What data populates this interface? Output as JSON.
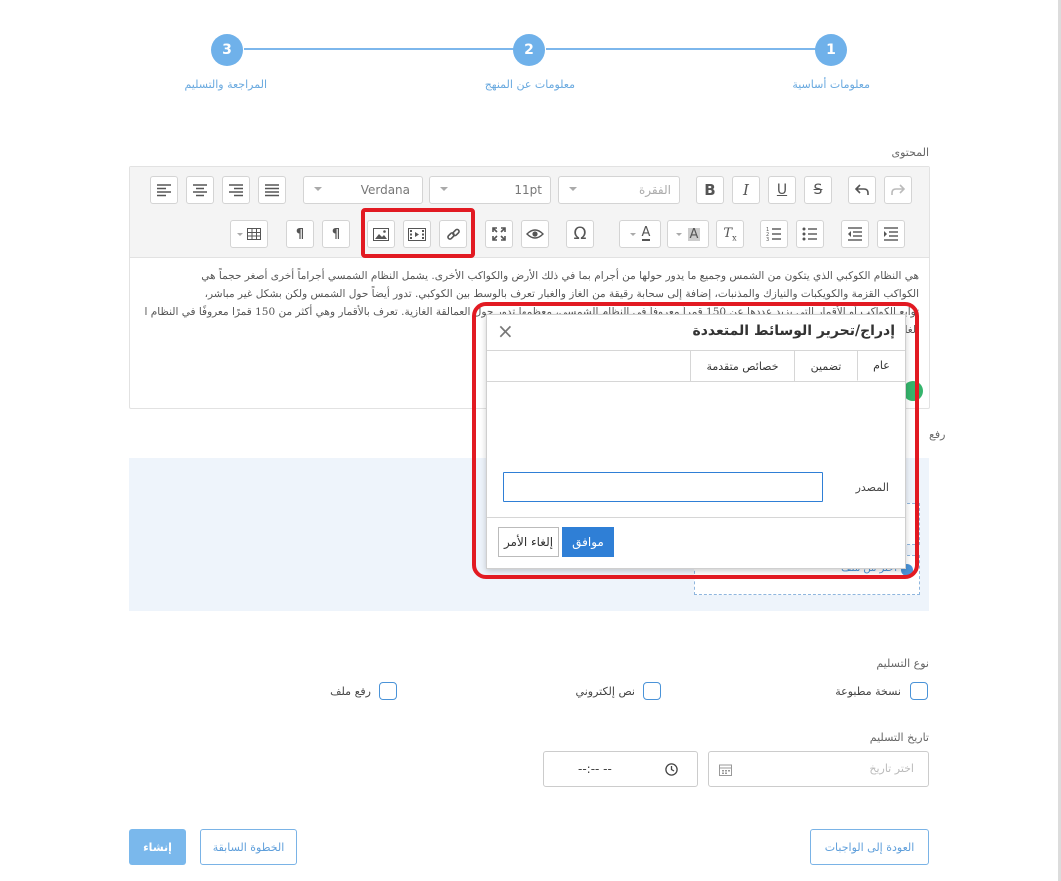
{
  "stepper": {
    "steps": [
      {
        "number": "1",
        "label": "معلومات أساسية"
      },
      {
        "number": "2",
        "label": "معلومات عن المنهج"
      },
      {
        "number": "3",
        "label": "المراجعة والتسليم"
      }
    ]
  },
  "content_label": "المحتوى",
  "editor": {
    "font_size": "11pt",
    "font_family": "Verdana",
    "paragraph_format": "الفقرة",
    "text_lines": [
      "هي النظام الكوكبي الذي يتكون من الشمس وجميع ما يدور حولها من أجرام بما في ذلك الأرض والكواكب الأخرى. يشمل النظام الشمسي أجراماً أخرى أصغر حجماً هي",
      "الكواكب القزمة والكويكبات والنيازك والمذنبات، إضافة إلى سحابة رقيقة من الغاز والغبار تعرف بالوسط بين الكوكبي. تدور أيضاً حول الشمس ولكن بشكل غير مباشر،",
      "توابع الكواكب أو الأقمار التي يزيد عددها عن 150 قمراً معروفاً في النظام الشمسي، معظمها تدور حول العمالقة الغازية. تعرف بالأقمار وهي أكثر من 150 قمرًا معروفًا في النظام الشمسي، معظمها تدور حول العمالقة",
      "الغازية"
    ]
  },
  "upload_label_partial": "رفع",
  "upload_choose_file": "اختر من ملف",
  "modal": {
    "title": "إدراج/تحرير الوسائط المتعددة",
    "tabs": [
      "عام",
      "تضمين",
      "خصائص متقدمة"
    ],
    "source_label": "المصدر",
    "source_value": "",
    "ok_label": "موافق",
    "cancel_label": "إلغاء الأمر"
  },
  "delivery": {
    "label": "نوع التسليم",
    "options": [
      "نسخة مطبوعة",
      "نص إلكتروني",
      "رفع ملف"
    ]
  },
  "date": {
    "label": "تاريخ التسليم",
    "date_placeholder": "اختر تاريخ",
    "time_value": "--:-- --"
  },
  "buttons": {
    "back_to_assignments": "العودة إلى الواجبات",
    "previous_step": "الخطوة السابقة",
    "create": "إنشاء"
  },
  "colors": {
    "accent": "#6fb1ea",
    "primary_button": "#2f7fd6",
    "highlight": "#e21a22"
  }
}
